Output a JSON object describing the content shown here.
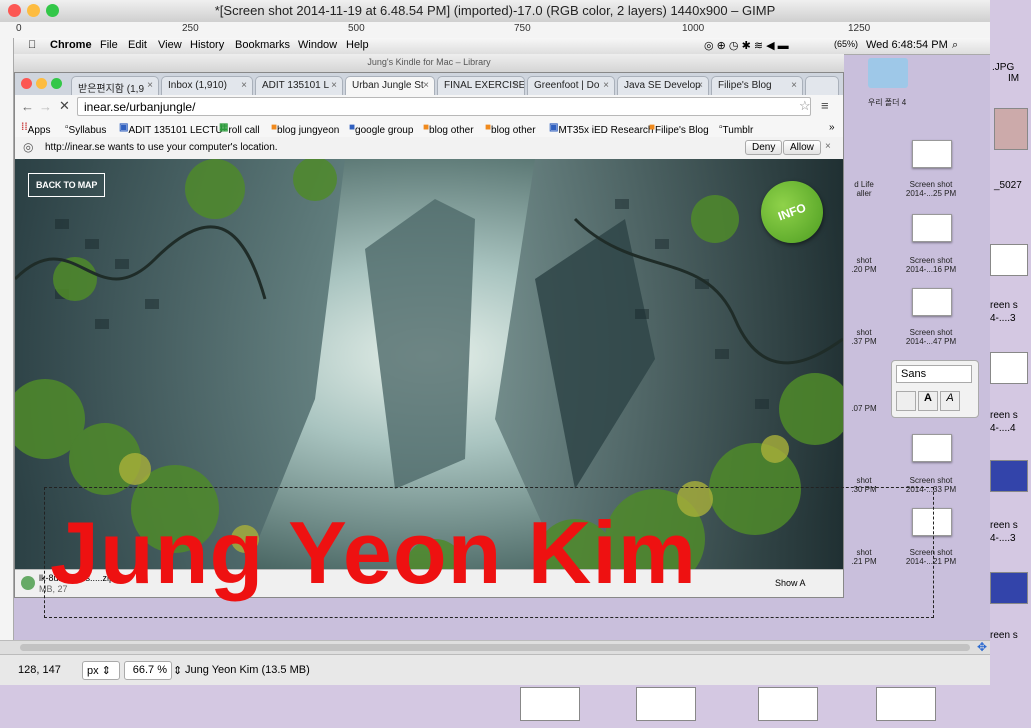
{
  "gimp": {
    "title": "*[Screen shot 2014-11-19 at 6.48.54 PM] (imported)-17.0 (RGB color, 2 layers) 1440x900 – GIMP",
    "ruler_labels": [
      "0",
      "250",
      "500",
      "750",
      "1000",
      "1250"
    ],
    "status": {
      "coords": "128, 147",
      "unit": "px",
      "zoom": "66.7 %",
      "layer_info": "Jung Yeon Kim  (13.5 MB)"
    }
  },
  "mac_menubar": {
    "apple": "",
    "items": [
      "Chrome",
      "File",
      "Edit",
      "View",
      "History",
      "Bookmarks",
      "Window",
      "Help"
    ],
    "battery": "(65%)",
    "clock": "Wed 6:48:54 PM"
  },
  "kindle_title": "Jung's Kindle for Mac – Library",
  "chrome": {
    "tabs": [
      {
        "label": "받은편지함 (1,9"
      },
      {
        "label": "Inbox (1,910)"
      },
      {
        "label": "ADIT 135101 L"
      },
      {
        "label": "Urban Jungle St",
        "active": true
      },
      {
        "label": "FINAL EXERCISE"
      },
      {
        "label": "Greenfoot | Do"
      },
      {
        "label": "Java SE Develop"
      },
      {
        "label": "Filipe's Blog"
      }
    ],
    "url": "inear.se/urbanjungle/",
    "bookmarks": [
      "Apps",
      "Syllabus",
      "ADIT 135101 LECTU",
      "roll call",
      "blog jungyeon",
      "google group",
      "blog other",
      "blog other",
      "MT35x iED Research",
      "Filipe's Blog",
      "Tumblr"
    ],
    "infobar": {
      "message": "http://inear.se wants to use your computer's location.",
      "deny": "Deny",
      "allow": "Allow"
    },
    "download_bar": {
      "file": "lk-8u2...acos.....zip",
      "size": "MB, 27",
      "show_all": "Show A"
    }
  },
  "page": {
    "back_to_map": "BACK TO MAP",
    "info": "INFO"
  },
  "desktop": {
    "icons": [
      {
        "label": "우리 폴더 4"
      },
      {
        "label": "Screen shot 2014-...25 PM"
      },
      {
        "label": "Screen shot 2014-...16 PM"
      },
      {
        "label": "Screen shot 2014-...47 PM"
      },
      {
        "label": "Screen shot 2014-...33 PM"
      },
      {
        "label": "Screen shot 2014-...21 PM"
      }
    ],
    "partial_labels": [
      "d Life",
      "aller",
      "shot",
      ".20 PM",
      "shot",
      ".37 PM",
      ".07 PM",
      "shot",
      ".30 PM",
      "shot",
      ".21 PM"
    ],
    "far_right": [
      ".JPG",
      "IM",
      "_5027",
      "reen s",
      "4-....3",
      "reen s",
      "4-....4",
      "reen s",
      "4-....3",
      "reen s"
    ]
  },
  "font_panel": {
    "font": "Sans"
  },
  "overlay_text": "Jung Yeon Kim",
  "colors": {
    "overlay_red": "#ee1111",
    "info_green": "#5aa82a"
  }
}
